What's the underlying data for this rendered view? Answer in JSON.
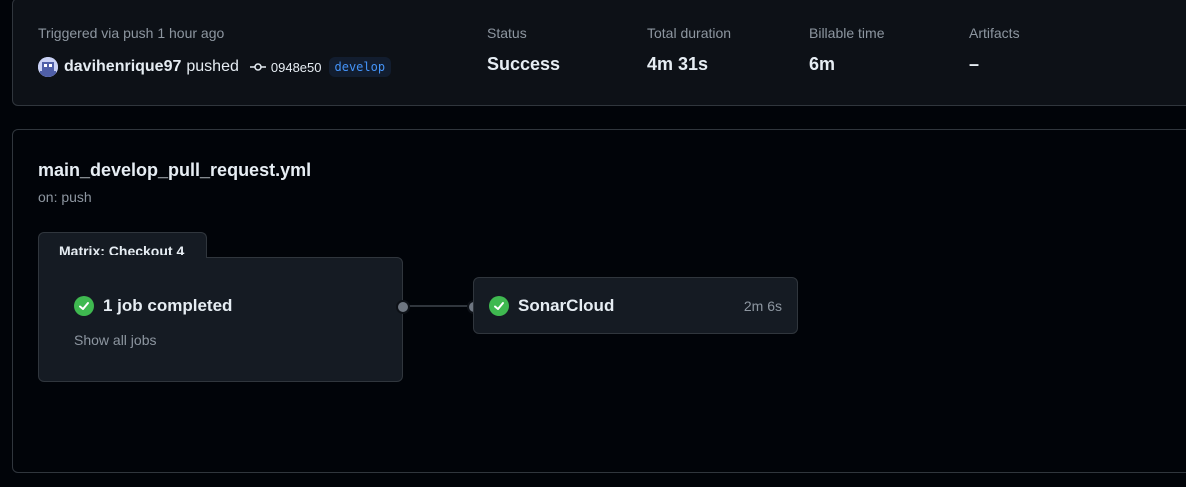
{
  "summary": {
    "trigger_label": "Triggered via push 1 hour ago",
    "pusher": "davihenrique97",
    "pushed_word": "pushed",
    "commit_sha": "0948e50",
    "branch": "develop",
    "stats": [
      {
        "label": "Status",
        "value": "Success"
      },
      {
        "label": "Total duration",
        "value": "4m 31s"
      },
      {
        "label": "Billable time",
        "value": "6m"
      },
      {
        "label": "Artifacts",
        "value": "–"
      }
    ]
  },
  "workflow": {
    "filename": "main_develop_pull_request.yml",
    "trigger": "on: push",
    "matrix": {
      "title": "Matrix: Checkout 4",
      "jobs_summary": "1 job completed",
      "show_all": "Show all jobs"
    },
    "job": {
      "name": "SonarCloud",
      "duration": "2m 6s"
    }
  },
  "colors": {
    "success": "#3fb950",
    "branch_text": "#4493f8",
    "background": "#010409",
    "panel": "#0d1117",
    "card": "#151b23",
    "border": "#30363d"
  },
  "icons": {
    "avatar": "user-avatar",
    "commit": "git-commit-icon",
    "success": "check-circle-icon"
  }
}
